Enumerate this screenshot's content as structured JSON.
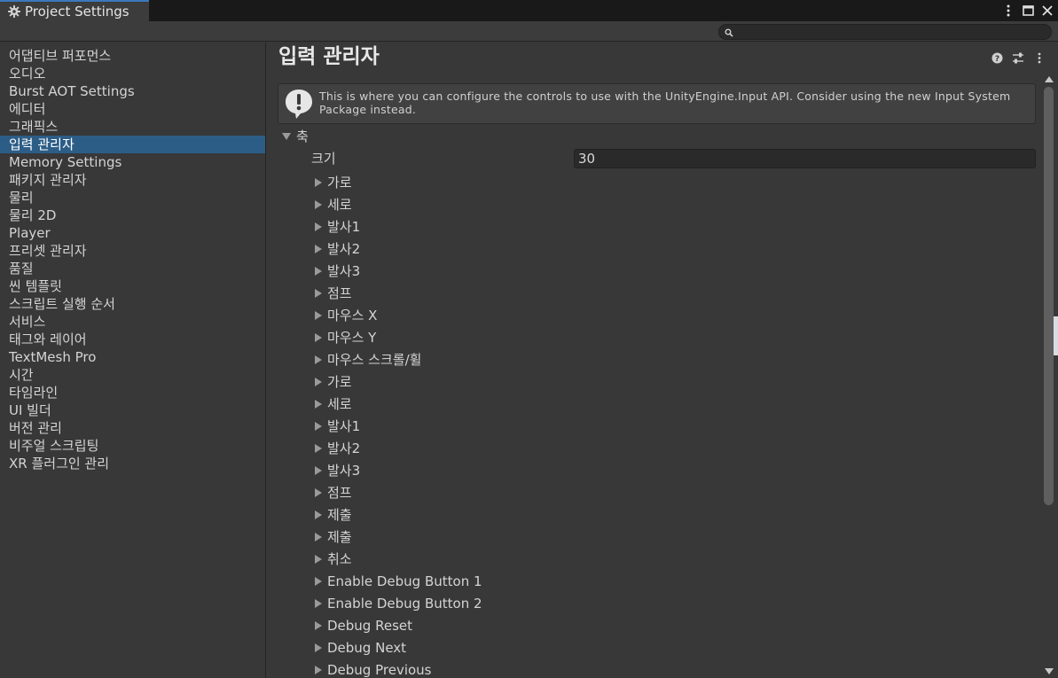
{
  "window": {
    "tab_title": "Project Settings",
    "icons": [
      "gear-icon",
      "kebab-menu-icon",
      "maximize-icon",
      "close-icon"
    ]
  },
  "search": {
    "placeholder": "",
    "value": ""
  },
  "sidebar": {
    "items": [
      "어댑티브 퍼포먼스",
      "오디오",
      "Burst AOT Settings",
      "에디터",
      "그래픽스",
      "입력 관리자",
      "Memory Settings",
      "패키지 관리자",
      "물리",
      "물리 2D",
      "Player",
      "프리셋 관리자",
      "품질",
      "씬 템플릿",
      "스크립트 실행 순서",
      "서비스",
      "태그와 레이어",
      "TextMesh Pro",
      "시간",
      "타임라인",
      "UI 빌더",
      "버전 관리",
      "비주얼 스크립팅",
      "XR 플러그인 관리"
    ],
    "selected_index": 5
  },
  "main": {
    "title": "입력 관리자",
    "help_message": "This is where you can configure the controls to use with the UnityEngine.Input API. Consider using the new Input System Package instead.",
    "axes_label": "축",
    "size_label": "크기",
    "size_value": "30",
    "axes": [
      "가로",
      "세로",
      "발사1",
      "발사2",
      "발사3",
      "점프",
      "마우스 X",
      "마우스 Y",
      "마우스 스크롤/휠",
      "가로",
      "세로",
      "발사1",
      "발사2",
      "발사3",
      "점프",
      "제출",
      "제출",
      "취소",
      "Enable Debug Button 1",
      "Enable Debug Button 2",
      "Debug Reset",
      "Debug Next",
      "Debug Previous"
    ]
  },
  "colors": {
    "selection": "#2c5d87",
    "tab_accent": "#3a79bb",
    "background": "#383838"
  }
}
